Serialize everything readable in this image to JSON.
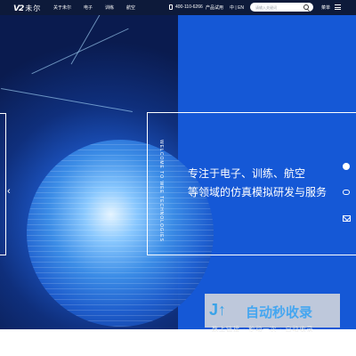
{
  "header": {
    "logo_mark": "V2",
    "logo_text": "未尔",
    "nav": [
      "关于未尔",
      "电子",
      "训练",
      "航空"
    ],
    "phone": "400-110-6266",
    "trial_label": "产品试用",
    "lang_label": "中 | EN",
    "search_placeholder": "请输入关键词",
    "menu_label": "菜单"
  },
  "hero": {
    "vertical_text": "WELCOME TO WEE TECHNOLOGIES",
    "slogan_line1": "专注于电子、训练、航空",
    "slogan_line2": "等领域的仿真模拟研发与服务",
    "prev_arrow": "‹"
  },
  "side_icons": [
    "person-icon",
    "chat-icon",
    "mail-icon"
  ],
  "watermark": {
    "title": "自动秒收录",
    "subtitle": "数上链接 · 秒动一次 · 自动收录"
  },
  "colors": {
    "header_bg": "#0d1a3a",
    "right_panel": "#1558d6",
    "watermark_text": "#44a6f0"
  }
}
